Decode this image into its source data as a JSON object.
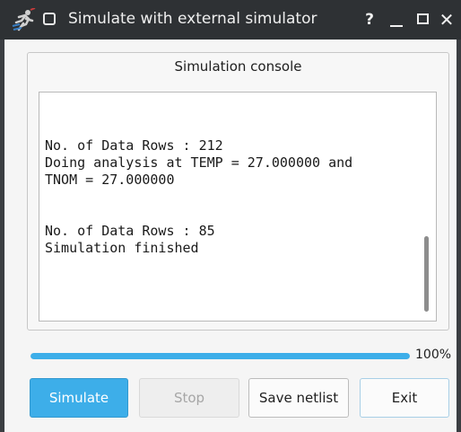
{
  "window": {
    "title": "Simulate with external simulator",
    "help_label": "?",
    "close_label": "✕"
  },
  "group": {
    "title": "Simulation console"
  },
  "console": {
    "text": "No. of Data Rows : 212\nDoing analysis at TEMP = 27.000000 and\nTNOM = 27.000000\n\n\nNo. of Data Rows : 85\nSimulation finished"
  },
  "progress": {
    "percent": 100,
    "label": "100%"
  },
  "buttons": {
    "simulate": "Simulate",
    "stop": "Stop",
    "save_netlist": "Save netlist",
    "exit": "Exit"
  },
  "colors": {
    "accent": "#3daee9",
    "titlebar": "#2e3134"
  },
  "icons": {
    "app": "runner-app-icon",
    "menu": "window-menu-icon",
    "help": "help-icon",
    "minimize": "minimize-icon",
    "maximize": "maximize-icon",
    "close": "close-icon"
  }
}
